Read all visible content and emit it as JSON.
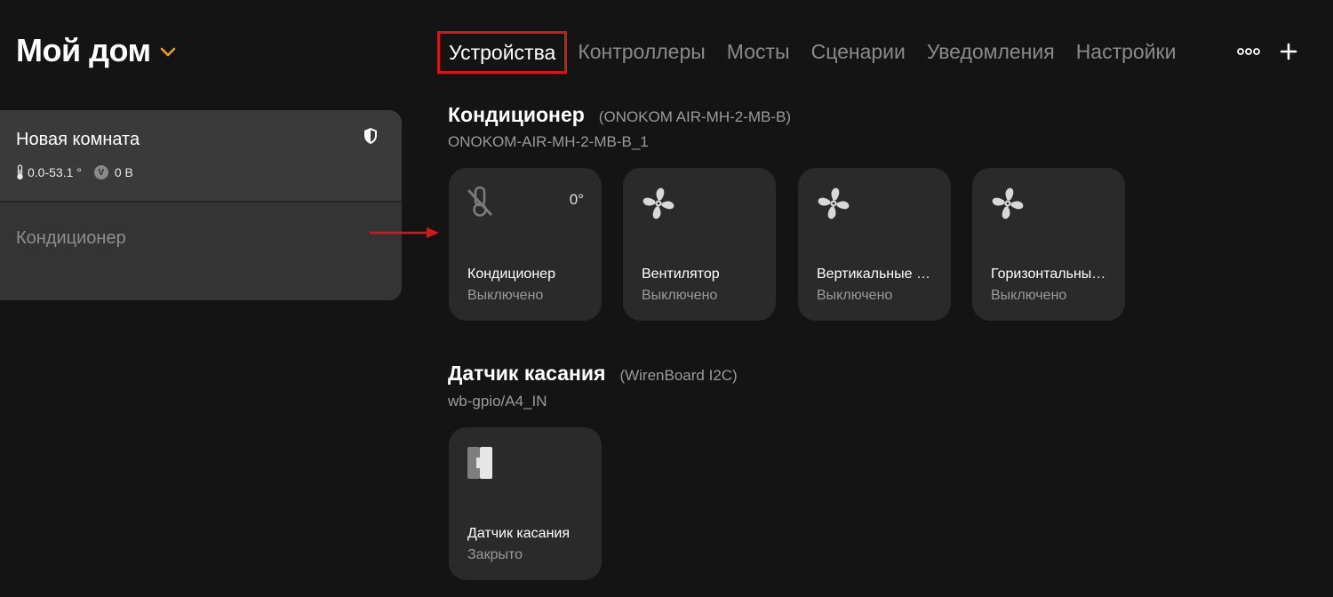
{
  "header": {
    "home_title": "Мой дом",
    "tabs": [
      {
        "label": "Устройства",
        "active": true
      },
      {
        "label": "Контроллеры"
      },
      {
        "label": "Мосты"
      },
      {
        "label": "Сценарии"
      },
      {
        "label": "Уведомления"
      },
      {
        "label": "Настройки"
      }
    ],
    "more_icon": "dots-icon",
    "add_icon": "plus-icon"
  },
  "sidebar": {
    "room": {
      "name": "Новая комната",
      "temperature": "0.0-53.1 °",
      "voltage_badge": "V",
      "voltage": "0 В"
    },
    "items": [
      {
        "label": "Кондиционер"
      }
    ]
  },
  "groups": [
    {
      "name": "Кондиционер",
      "model": "(ONOKOM AIR-MH-2-MB-B)",
      "id": "ONOKOM-AIR-MH-2-MB-B_1",
      "tiles": [
        {
          "icon": "thermometer-off-icon",
          "name": "Кондиционер",
          "status": "Выключено",
          "value": "0°"
        },
        {
          "icon": "fan-icon",
          "name": "Вентилятор",
          "status": "Выключено"
        },
        {
          "icon": "fan-icon",
          "name": "Вертикальные …",
          "status": "Выключено"
        },
        {
          "icon": "fan-icon",
          "name": "Горизонтальны…",
          "status": "Выключено"
        }
      ]
    },
    {
      "name": "Датчик касания",
      "model": "(WirenBoard I2C)",
      "id": "wb-gpio/A4_IN",
      "tiles": [
        {
          "icon": "contact-sensor-icon",
          "name": "Датчик касания",
          "status": "Закрыто"
        }
      ]
    }
  ],
  "colors": {
    "background": "#141414",
    "tile": "#2a2a2a",
    "accent": "#f0a020",
    "highlight": "#d0191b"
  }
}
